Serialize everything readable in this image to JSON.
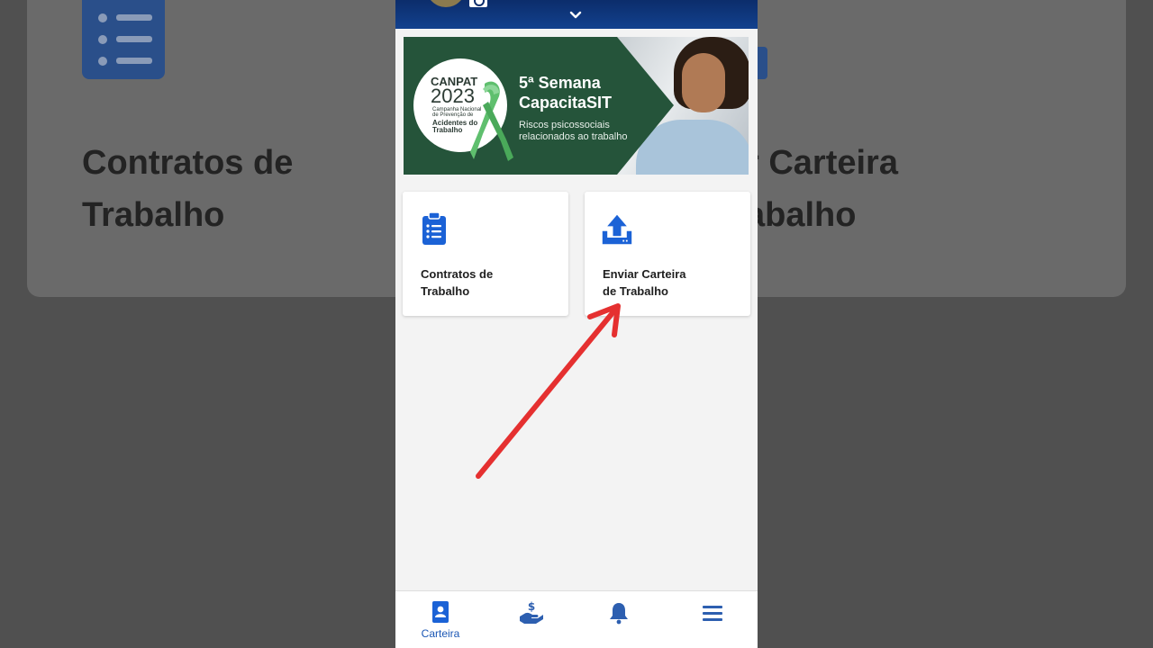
{
  "background": {
    "left_text": "Contratos de\nTrabalho",
    "right_text": "r Carteira\nabalho"
  },
  "banner": {
    "badge_title": "CANPAT",
    "badge_year": "2023",
    "badge_small": "Campanha Nacional de Prevenção de",
    "badge_bold": "Acidentes do Trabalho",
    "headline": "5ª Semana\nCapacitaSIT",
    "subtitle": "Riscos psicossociais\nrelacionados ao trabalho"
  },
  "cards": [
    {
      "label": "Contratos de\nTrabalho",
      "icon": "clipboard-list-icon"
    },
    {
      "label": "Enviar Carteira\nde Trabalho",
      "icon": "upload-tray-icon"
    }
  ],
  "bottom_nav": [
    {
      "label": "Carteira",
      "icon": "id-card-icon",
      "active": true
    },
    {
      "label": "",
      "icon": "hand-money-icon",
      "active": false
    },
    {
      "label": "",
      "icon": "bell-icon",
      "active": false
    },
    {
      "label": "",
      "icon": "menu-icon",
      "active": false
    }
  ],
  "colors": {
    "primary": "#1b57b5",
    "header": "#0c2d6b",
    "banner_green": "#25543a",
    "annotation_red": "#e53030"
  }
}
